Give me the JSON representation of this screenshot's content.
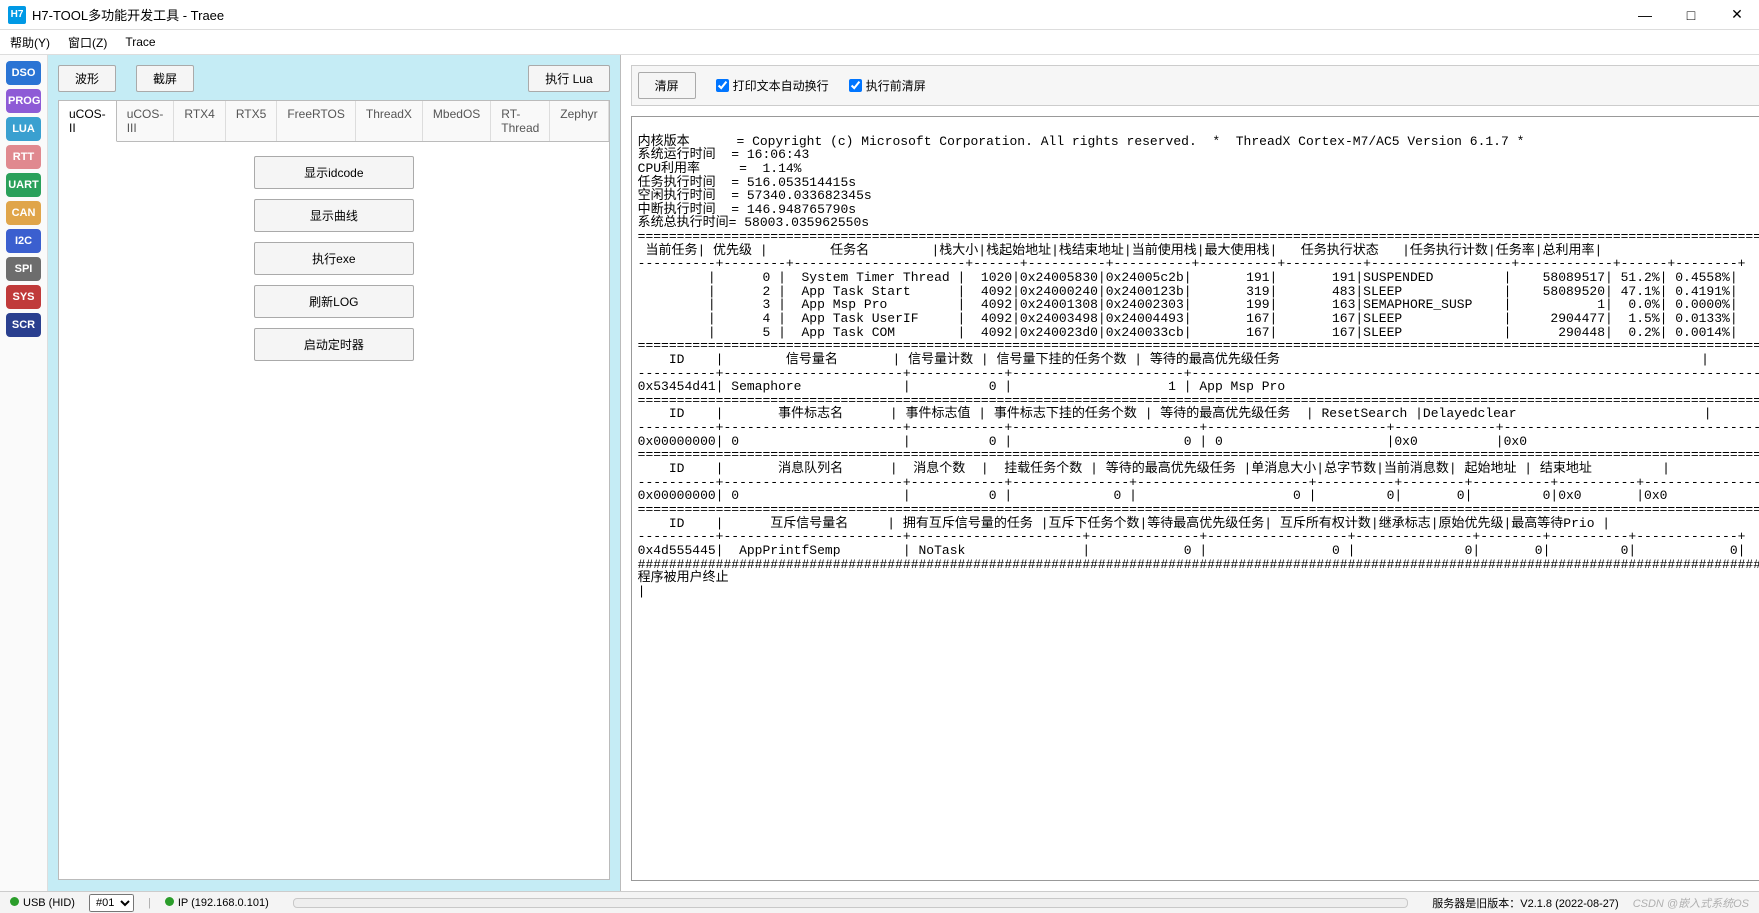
{
  "window": {
    "icon_text": "H7",
    "title": "H7-TOOL多功能开发工具 - Traee"
  },
  "win_buttons": {
    "min": "—",
    "max": "□",
    "close": "✕"
  },
  "menu": [
    "帮助(Y)",
    "窗口(Z)",
    "Trace"
  ],
  "side_rail": [
    {
      "label": "DSO",
      "bg": "#2a74d4"
    },
    {
      "label": "PROG",
      "bg": "#8e5bd6"
    },
    {
      "label": "LUA",
      "bg": "#3aa0d0"
    },
    {
      "label": "RTT",
      "bg": "#e0898f"
    },
    {
      "label": "UART",
      "bg": "#2aa05a"
    },
    {
      "label": "CAN",
      "bg": "#e0a54a"
    },
    {
      "label": "I2C",
      "bg": "#3b5fcf"
    },
    {
      "label": "SPI",
      "bg": "#6d6d6d"
    },
    {
      "label": "SYS",
      "bg": "#c03a3a"
    },
    {
      "label": "SCR",
      "bg": "#2a3f8f"
    }
  ],
  "center": {
    "top_buttons": {
      "wave": "波形",
      "screenshot": "截屏",
      "run_lua": "执行 Lua"
    },
    "tabs": [
      "uCOS-II",
      "uCOS-III",
      "RTX4",
      "RTX5",
      "FreeRTOS",
      "ThreadX",
      "MbedOS",
      "RT-Thread",
      "Zephyr"
    ],
    "active_tab": 0,
    "big_buttons": [
      "显示idcode",
      "显示曲线",
      "执行exe",
      "刷新LOG",
      "启动定时器"
    ]
  },
  "right": {
    "clear": "清屏",
    "chk_wrap": "打印文本自动换行",
    "chk_preclear": "执行前清屏",
    "log_lines": [
      "",
      "内核版本      = Copyright (c) Microsoft Corporation. All rights reserved.  *  ThreadX Cortex-M7/AC5 Version 6.1.7 *",
      "系统运行时间  = 16:06:43",
      "CPU利用率     =  1.14%",
      "任务执行时间  = 516.053514415s",
      "空闲执行时间  = 57340.033682345s",
      "中断执行时间  = 146.948765790s",
      "系统总执行时间= 58003.035962550s",
      "==================================================================================================================================================",
      " 当前任务| 优先级 |        任务名        |栈大小|栈起始地址|栈结束地址|当前使用栈|最大使用栈|   任务执行状态   |任务执行计数|任务率|总利用率|",
      "----------+--------+----------------------+------+----------+----------+----------+----------+------------------+------------+------+--------+",
      "         |      0 |  System Timer Thread |  1020|0x24005830|0x24005c2b|       191|       191|SUSPENDED         |    58089517| 51.2%| 0.4558%|",
      "         |      2 |  App Task Start      |  4092|0x24000240|0x2400123b|       319|       483|SLEEP             |    58089520| 47.1%| 0.4191%|",
      "         |      3 |  App Msp Pro         |  4092|0x24001308|0x24002303|       199|       163|SEMAPHORE_SUSP    |           1|  0.0%| 0.0000%|",
      "         |      4 |  App Task UserIF     |  4092|0x24003498|0x24004493|       167|       167|SLEEP             |     2904477|  1.5%| 0.0133%|",
      "         |      5 |  App Task COM        |  4092|0x240023d0|0x240033cb|       167|       167|SLEEP             |      290448|  0.2%| 0.0014%|",
      "==================================================================================================================================================",
      "    ID    |        信号量名       | 信号量计数 | 信号量下挂的任务个数 | 等待的最高优先级任务                                                      |",
      "----------+-----------------------+------------+----------------------+---------------------------------------------------------------------------+",
      "0x53454d41| Semaphore             |          0 |                    1 | App Msp Pro                                                               |",
      "==================================================================================================================================================",
      "    ID    |       事件标志名      | 事件标志值 | 事件标志下挂的任务个数 | 等待的最高优先级任务  | ResetSearch |Delayedclear                        |",
      "----------+-----------------------+------------+------------------------+-----------------------+-------------+------------------------------------+",
      "0x00000000| 0                     |          0 |                      0 | 0                     |0x0          |0x0                                 |",
      "==================================================================================================================================================",
      "    ID    |       消息队列名      |  消息个数  |  挂载任务个数 | 等待的最高优先级任务 |单消息大小|总字节数|当前消息数| 起始地址 | 结束地址         |",
      "----------+-----------------------+------------+---------------+----------------------+----------+--------+----------+----------+------------------+",
      "0x00000000| 0                     |          0 |             0 |                    0 |         0|       0|         0|0x0       |0x0               |",
      "==================================================================================================================================================",
      "    ID    |      互斥信号量名     | 拥有互斥信号量的任务 |互斥下任务个数|等待最高优先级任务| 互斥所有权计数|继承标志|原始优先级|最高等待Prio |",
      "----------+-----------------------+----------------------+--------------+------------------+---------------+--------+----------+-------------+",
      "0x4d555445|  AppPrintfSemp        | NoTask               |            0 |                0 |              0|       0|         0|            0|",
      "##################################################################################################################################################",
      "程序被用户终止",
      "|"
    ]
  },
  "status": {
    "conn": "USB (HID)",
    "channel": "#01",
    "ip_label": "IP (192.168.0.101)",
    "server": "服务器是旧版本：V2.1.8 (2022-08-27)",
    "watermark": "CSDN @嵌入式系统OS"
  }
}
